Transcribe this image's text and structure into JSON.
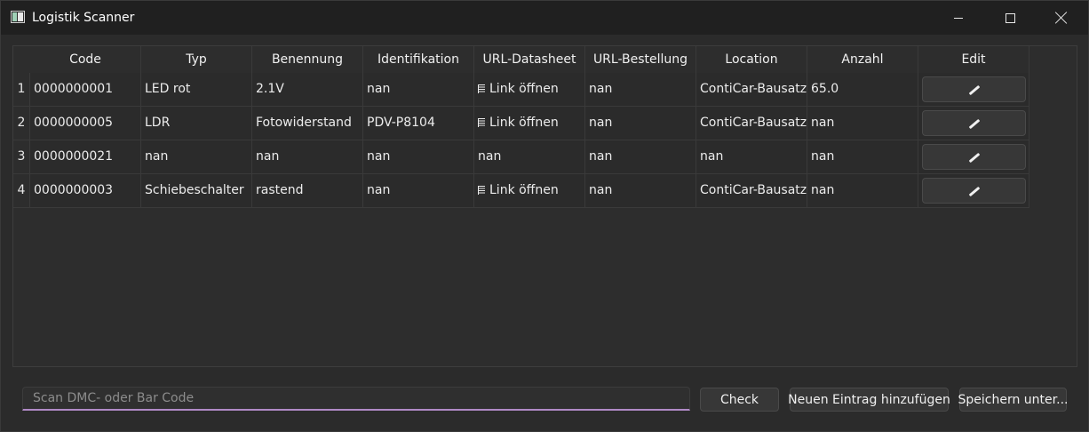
{
  "window": {
    "title": "Logistik Scanner"
  },
  "table": {
    "columns": [
      "Code",
      "Typ",
      "Benennung",
      "Identifikation",
      "URL-Datasheet",
      "URL-Bestellung",
      "Location",
      "Anzahl",
      "Edit"
    ],
    "rows": [
      {
        "num": "1",
        "cells": [
          "0000000001",
          "LED rot",
          "2.1V",
          "nan",
          "Link öffnen",
          "nan",
          "ContiCar-Bausatz",
          "65.0"
        ]
      },
      {
        "num": "2",
        "cells": [
          "0000000005",
          "LDR",
          "Fotowiderstand",
          "PDV-P8104",
          "Link öffnen",
          "nan",
          "ContiCar-Bausatz",
          "nan"
        ]
      },
      {
        "num": "3",
        "cells": [
          "0000000021",
          "nan",
          "nan",
          "nan",
          "nan",
          "nan",
          "nan",
          "nan"
        ]
      },
      {
        "num": "4",
        "cells": [
          "0000000003",
          "Schiebeschalter",
          "rastend",
          "nan",
          "Link öffnen",
          "nan",
          "ContiCar-Bausatz",
          "nan"
        ]
      }
    ]
  },
  "scan": {
    "placeholder": "Scan DMC- oder Bar Code"
  },
  "buttons": {
    "check": "Check",
    "add": "Neuen Eintrag hinzufügen",
    "save": "Speichern unter..."
  },
  "colors": {
    "accent": "#b08ac6",
    "background": "#2b2b2b",
    "titlebar": "#202020"
  }
}
